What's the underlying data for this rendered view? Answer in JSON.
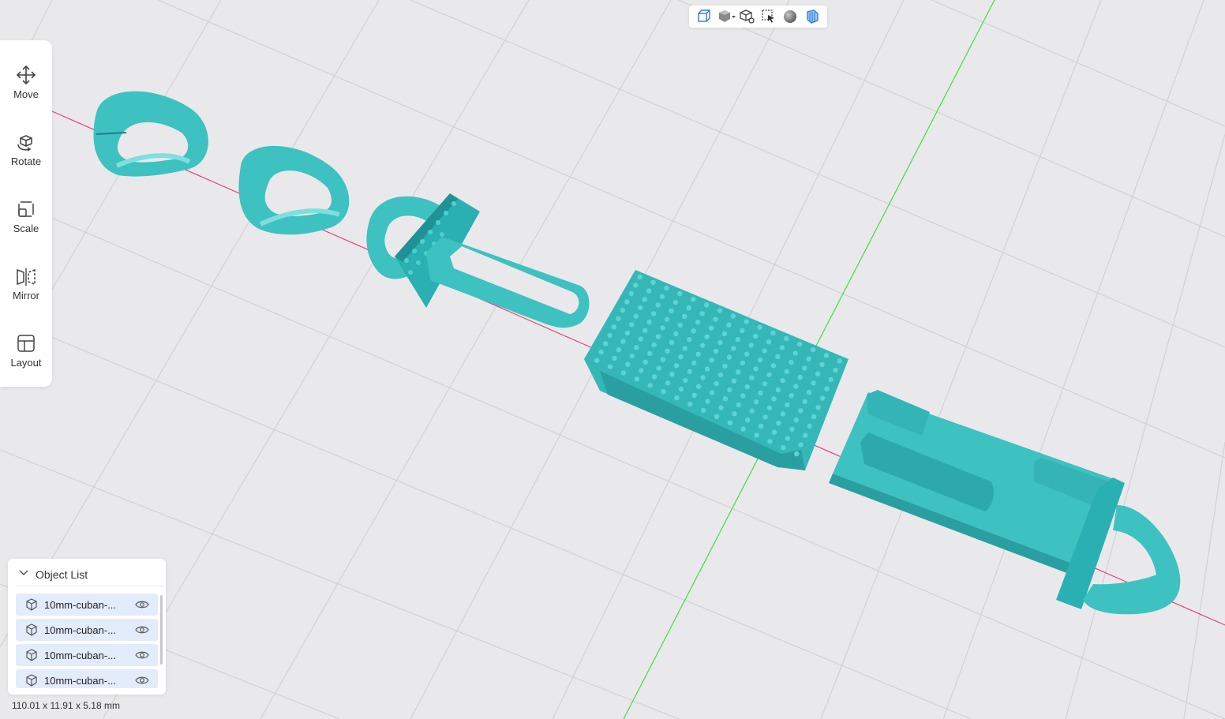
{
  "tools": [
    {
      "label": "Move",
      "icon": "move-icon"
    },
    {
      "label": "Rotate",
      "icon": "rotate-icon"
    },
    {
      "label": "Scale",
      "icon": "scale-icon"
    },
    {
      "label": "Mirror",
      "icon": "mirror-icon"
    },
    {
      "label": "Layout",
      "icon": "layout-icon"
    }
  ],
  "view_modes": [
    "wireframe-box-icon",
    "solid-cube-dropdown-icon",
    "view-cube-icon",
    "select-cursor-icon",
    "shaded-sphere-icon",
    "x-ray-icon"
  ],
  "object_list": {
    "title": "Object List",
    "items": [
      {
        "name": "10mm-cuban-..."
      },
      {
        "name": "10mm-cuban-..."
      },
      {
        "name": "10mm-cuban-..."
      },
      {
        "name": "10mm-cuban-..."
      }
    ]
  },
  "dimensions": "110.01 x 11.91 x 5.18 mm",
  "colors": {
    "model": "#3ec1c1",
    "model_dark": "#28a3a6",
    "background": "#e9e9eb",
    "grid": "#d2d2d4",
    "x_axis": "#e0457a",
    "y_axis": "#3ee03e",
    "accent": "#2f7be5"
  }
}
